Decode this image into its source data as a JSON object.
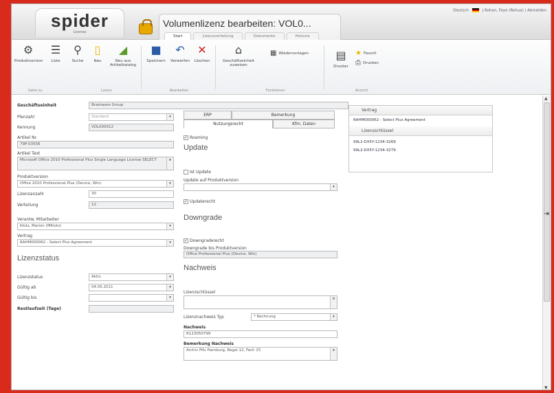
{
  "app": {
    "logo_text": "spider",
    "logo_sub": "License",
    "title": "Volumenlizenz bearbeiten: VOL0...",
    "user_info_left": "Deutsch",
    "user_info_right": "| Rohan, Faye (Rohua) | Abmelden"
  },
  "ribbon_tabs": [
    "Start",
    "Lizenzverteilung",
    "Dokumente",
    "Historie"
  ],
  "toolbar": {
    "produktversion": "Produktversion",
    "liste": "Liste",
    "suche": "Suche",
    "neu": "Neu",
    "neu_aus_artikelkatalog": "Neu aus Artikelkatalog",
    "speichern": "Speichern",
    "verwerfen": "Verwerfen",
    "loeschen": "Löschen",
    "geschaeftseinheit_zuweisen": "Geschäftseinheit zuweisen",
    "wiedervorlagen": "Wiedervorlagen",
    "drucker": "Drucker",
    "favorit": "Favorit",
    "drucken": "Drucken",
    "groups": [
      "Gehe zu",
      "Lizenz",
      "Bearbeiten",
      "Funktionen",
      "Ansicht"
    ]
  },
  "form": {
    "geschaeftseinheit_label": "Geschäftseinheit",
    "geschaeftseinheit_value": "Brainware Group",
    "plenzahl_label": "Plenzahl",
    "plenzahl_value": "Standard",
    "kennung_label": "Kennung",
    "kennung_value": "VOL000012",
    "artikel_nr_label": "Artikel Nr.",
    "artikel_nr_value": "79P-03556",
    "artikel_text_label": "Artikel Text",
    "artikel_text_value": "Microsoft Office 2010 Professional Plus Single Language License SELECT",
    "produktversion_label": "Produktversion",
    "produktversion_value": "Office 2010 Professional Plus (Device, Win)",
    "lizenzanzahl_label": "Lizenzanzahl",
    "lizenzanzahl_value": "30",
    "verteilung_label": "Verteilung",
    "verteilung_value": "12",
    "verantw_label": "Verantw. Mitarbeiter",
    "verantw_value": "Klotz, Marion (MKlotz)",
    "vertrag_label": "Vertrag",
    "vertrag_value": "RAHM000062 - Select Plus Agreement",
    "lizenzstatus_title": "Lizenzstatus",
    "status_label": "Lizenzstatus",
    "status_value": "Aktiv",
    "gueltig_ab_label": "Gültig ab",
    "gueltig_ab_value": "04.05.2011",
    "gueltig_bis_label": "Gültig bis",
    "gueltig_bis_value": "",
    "restlaufzeit_label": "Restlaufzeit (Tage)",
    "restlaufzeit_value": ""
  },
  "subtabs": {
    "erp": "ERP",
    "bemerkung": "Bemerkung",
    "nutzungsrecht": "Nutzungsrecht",
    "kfm_daten": "Kfm. Daten"
  },
  "middle": {
    "roaming_label": "Roaming",
    "update_title": "Update",
    "ist_update_label": "Ist Update",
    "update_auf_label": "Update auf Produktversion",
    "update_auf_value": "",
    "updaterecht_label": "Updaterecht",
    "downgrade_title": "Downgrade",
    "downgraderecht_label": "Downgraderecht",
    "downgrade_bis_label": "Downgrade bis Produktversion",
    "downgrade_bis_value": "Office Professional Plus (Device, Win)",
    "nachweis_title": "Nachweis",
    "lizenzschluessel_label": "Lizenzschlüssel",
    "lizenzschluessel_value": "",
    "nachweis_typ_label": "Lizenznachweis Typ",
    "nachweis_typ_value": "* Rechnung",
    "nachweis_label": "Nachweis",
    "nachweis_value": "R123050799",
    "bemerkung_nachweis_label": "Bemerkung Nachweis",
    "bemerkung_nachweis_value": "Archiv Fifu Hamburg, Regal 12, Fach 15"
  },
  "right": {
    "vertrag_head": "Vertrag",
    "vertrag_item": "RAHM000062 - Select Plus Agreement",
    "lizenzschluessel_head": "Lizenzschlüssel",
    "keys": [
      "99L2-DX5Y-1234-3269",
      "99L2-DX5Y-1234-3279"
    ]
  }
}
